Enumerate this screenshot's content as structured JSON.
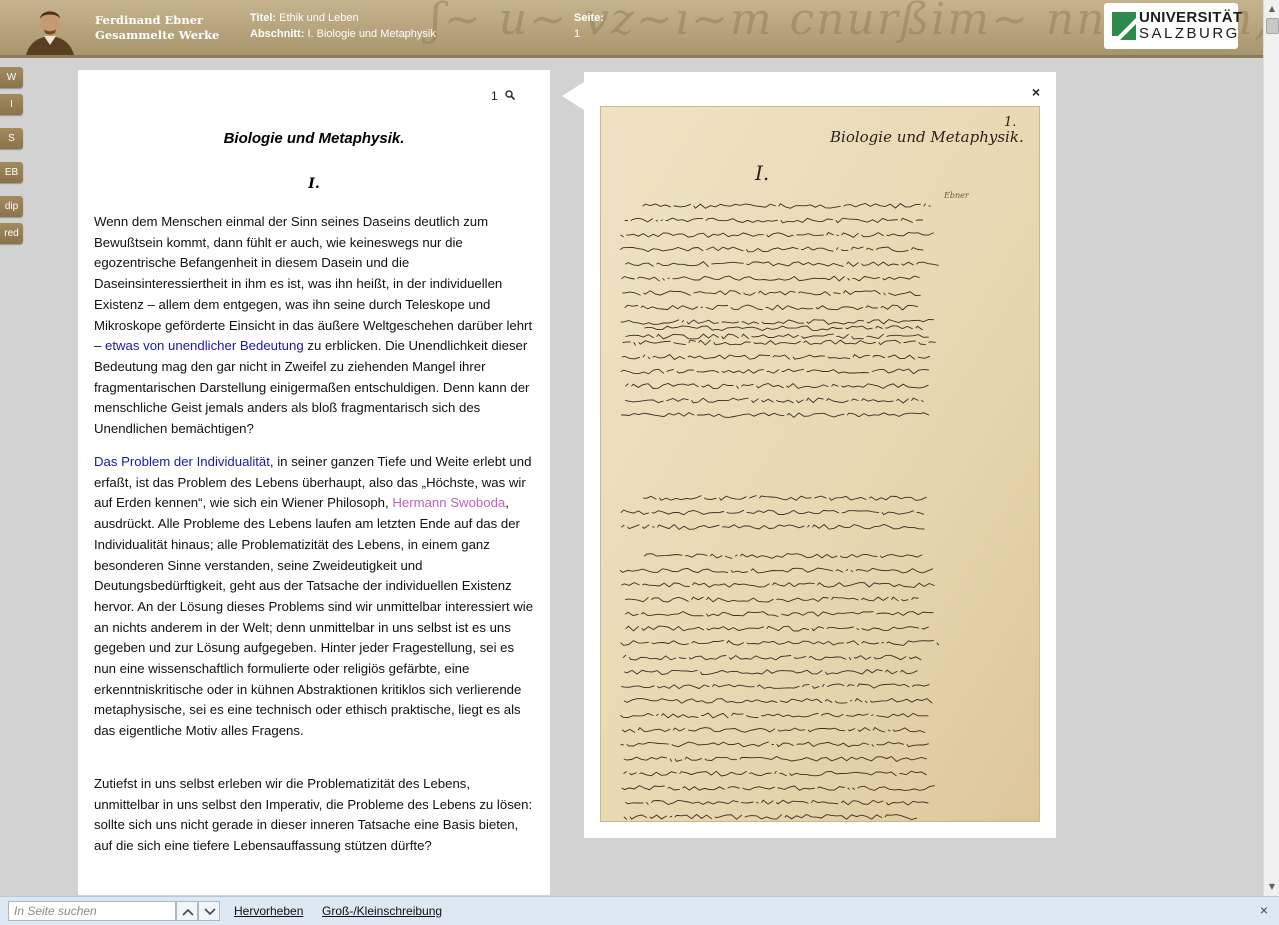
{
  "header": {
    "brand_line1": "Ferdinand Ebner",
    "brand_line2": "Gesammelte Werke",
    "title_label": "Titel:",
    "title_value": "Ethik und Leben",
    "section_label": "Abschnitt:",
    "section_value": "I. Biologie und Metaphysik",
    "page_label": "Seite:",
    "page_value": "1",
    "university_line1": "UNIVERSITÄT",
    "university_line2": "SALZBURG"
  },
  "side_buttons": [
    "W",
    "I",
    "S",
    "EB",
    "dip",
    "red"
  ],
  "text_panel": {
    "page_number": "1",
    "title": "Biologie und Metaphysik.",
    "chapter": "I.",
    "p1_a": "Wenn dem Menschen einmal der Sinn seines Daseins deutlich zum Bewußtsein kommt, dann fühlt er auch, wie keineswegs nur die egozentrische Befangenheit in diesem Dasein und die Daseinsinteressiertheit in ihm es ist, was ihn heißt, in der individuellen Existenz – allem dem entgegen, was ihn seine durch Teleskope und Mikroskope geförderte Einsicht in das äußere Weltgeschehen darüber lehrt – ",
    "p1_link": "etwas von unendlicher Bedeutung",
    "p1_b": " zu erblicken. Die Unendlichkeit dieser Bedeutung mag den gar nicht in Zweifel zu ziehenden Mangel ihrer fragmentarischen Darstellung einigermaßen entschuldigen. Denn kann der menschliche Geist jemals anders als bloß fragmentarisch sich des Unendlichen bemächtigen?",
    "p2_link1": "Das Problem der Individualität",
    "p2_a": ", in seiner ganzen Tiefe und Weite erlebt und erfaßt, ist das Problem des Lebens überhaupt, also das „Höchste, was wir auf Erden kennen“, wie sich ein Wiener Philosoph, ",
    "p2_link2": "Hermann Swoboda",
    "p2_b": ", ausdrückt. Alle Probleme des Lebens laufen am letzten Ende auf das der Individualität hinaus; alle Problematizität des Lebens, in einem ganz besonderen Sinne verstanden, seine Zweideutigkeit und Deutungsbedürftigkeit, geht aus der Tatsache der individuellen Existenz hervor. An der Lösung dieses Problems sind wir unmittelbar interessiert wie an nichts anderem in der Welt; denn unmittelbar in uns selbst ist es uns gegeben und zur Lösung aufgegeben. Hinter jeder Fragestellung, sei es nun eine wissenschaftlich formulierte oder religiös gefärbte, eine erkenntniskritische oder in kühnen Abstraktionen kritiklos sich verlierende metaphysische, sei es eine technisch oder ethisch praktische, liegt es als das eigentliche Motiv alles Fragens.",
    "p3": "Zutiefst in uns selbst erleben wir die Problematizität des Lebens, unmittelbar in uns selbst den Imperativ, die Probleme des Lebens zu lösen: sollte sich uns nicht gerade in dieser inneren Tatsache eine Basis bieten, auf die sich eine tiefere Lebensauffassung stützen dürfte?"
  },
  "facsimile": {
    "close_label": "×",
    "heading": "Biologie und Metaphysik.",
    "page_mark": "1.",
    "chapter": "I.",
    "corner_note": "Ebner"
  },
  "findbar": {
    "placeholder": "In Seite suchen",
    "highlight_label": "Hervorheben",
    "case_label": "Groß-/Kleinschreibung",
    "close_label": "×"
  },
  "colors": {
    "header_bg": "#b5a27b",
    "link_blue": "#1a1aa6",
    "link_pink": "#c060c0",
    "side_button": "#8a7349",
    "findbar_bg": "#dde8f3"
  }
}
